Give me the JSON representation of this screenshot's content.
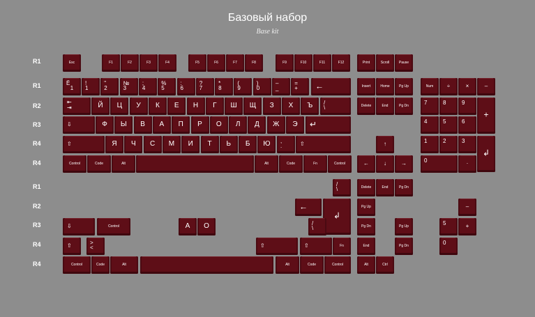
{
  "title": "Базовый набор",
  "subtitle": "Base kit",
  "row_labels": [
    "R1",
    "R1",
    "R2",
    "R3",
    "R4",
    "R4",
    "R1",
    "R2",
    "R3",
    "R4",
    "R4"
  ],
  "legends": {
    "esc": "Esc",
    "f1": "F1",
    "f2": "F2",
    "f3": "F3",
    "f4": "F4",
    "f5": "F5",
    "f6": "F6",
    "f7": "F7",
    "f8": "F8",
    "f9": "F9",
    "f10": "F10",
    "f11": "F11",
    "f12": "F12",
    "print": "Print",
    "scroll": "Scroll",
    "pause": "Pause",
    "yo": "Ё",
    "one": "1",
    "excl": "!",
    "two": "2",
    "quot": "\"",
    "three": "3",
    "no": "№",
    "four": "4",
    "semi": ";",
    "five": "5",
    "pct": "%",
    "six": "6",
    "colon": ":",
    "seven": "7",
    "q": "?",
    "eight": "8",
    "star": "*",
    "nine": "9",
    "lp": "(",
    "zero": "0",
    "rp": ")",
    "minus": "–",
    "under": "_",
    "eq": "=",
    "plus": "+",
    "backspace": "←",
    "insert": "Insert",
    "home": "Home",
    "pgup": "Pg Up",
    "num": "Num",
    "div": "÷",
    "mul": "×",
    "sub": "–",
    "tab": "⇤\n⇥",
    "й": "Й",
    "ц": "Ц",
    "у": "У",
    "к": "К",
    "е": "Е",
    "н": "Н",
    "г": "Г",
    "ш": "Ш",
    "щ": "Щ",
    "з": "З",
    "х": "Х",
    "ъ": "Ъ",
    "slash": "/",
    "bslash": "\\",
    "delete": "Delete",
    "end": "End",
    "pgdn": "Pg Dn",
    "n7": "7",
    "n8": "8",
    "n9": "9",
    "nplus": "+",
    "caps": "⇩",
    "ф": "Ф",
    "ы": "Ы",
    "в": "В",
    "а": "А",
    "п": "П",
    "р": "Р",
    "о": "О",
    "л": "Л",
    "д": "Д",
    "ж": "Ж",
    "э": "Э",
    "enter": "↵",
    "n4": "4",
    "n5": "5",
    "n6": "6",
    "shift": "⇧",
    "я": "Я",
    "ч": "Ч",
    "с": "С",
    "м": "М",
    "и": "И",
    "т": "Т",
    "ь": "Ь",
    "б": "Б",
    "ю": "Ю",
    "comma": ",",
    "dot": ".",
    "up": "↑",
    "n1": "1",
    "n2": "2",
    "n3": "3",
    "nenter": "↲",
    "control": "Control",
    "code": "Code",
    "alt": "Alt",
    "fn": "Fn",
    "left": "←",
    "down": "↓",
    "right": "→",
    "n0": "0",
    "ndot": "·",
    "ctrl": "Ctrl",
    "latin_a": "A",
    "latin_o": "O",
    "gt": ">",
    "lt": "<"
  }
}
